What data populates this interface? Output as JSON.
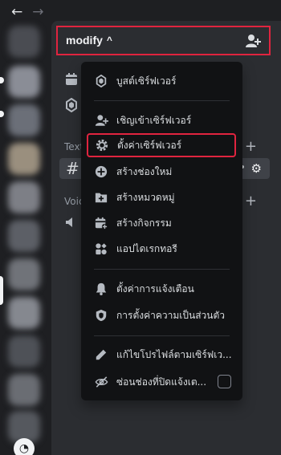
{
  "nav": {
    "back_icon": "arrow-left-icon",
    "forward_icon": "arrow-right-icon"
  },
  "server": {
    "name": "modify",
    "caret": "^",
    "invite_icon": "add-member-icon"
  },
  "background": {
    "text_category": "Text",
    "voice_category": "Voic",
    "channel_hash": "#"
  },
  "menu": {
    "items": [
      {
        "label": "บูสต์เซิร์ฟเวอร์",
        "icon": "boost-gem-icon"
      },
      {
        "label": "เชิญเข้าเซิร์ฟเวอร์",
        "icon": "invite-people-icon"
      },
      {
        "label": "ตั้งค่าเซิร์ฟเวอร์",
        "icon": "settings-gear-icon"
      },
      {
        "label": "สร้างช่องใหม่",
        "icon": "plus-circle-icon"
      },
      {
        "label": "สร้างหมวดหมู่",
        "icon": "folder-plus-icon"
      },
      {
        "label": "สร้างกิจกรรม",
        "icon": "calendar-plus-icon"
      },
      {
        "label": "แอปไดเรกทอรี",
        "icon": "app-directory-icon"
      },
      {
        "label": "ตั้งค่าการแจ้งเตือน",
        "icon": "bell-icon"
      },
      {
        "label": "การตั้งค่าความเป็นส่วนตัว",
        "icon": "shield-icon"
      },
      {
        "label": "แก้ไขโปรไฟล์ตามเซิร์ฟเว...",
        "icon": "pencil-icon"
      },
      {
        "label": "ซ่อนช่องที่ปิดแจ้งเต...",
        "icon": "eye-slash-icon"
      }
    ]
  },
  "colors": {
    "highlight": "#e0243f",
    "menu_bg": "#111214",
    "sidebar_bg": "#2b2d31"
  }
}
